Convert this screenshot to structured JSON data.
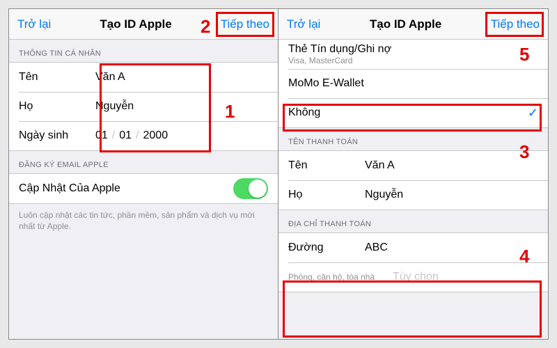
{
  "left": {
    "nav": {
      "back": "Trở lại",
      "title": "Tạo ID Apple",
      "next": "Tiếp theo"
    },
    "sections": {
      "personal_header": "THÔNG TIN CÁ NHÂN",
      "first_name_label": "Tên",
      "first_name_value": "Văn A",
      "last_name_label": "Họ",
      "last_name_value": "Nguyễn",
      "birth_label": "Ngày sinh",
      "birth_d": "01",
      "birth_m": "01",
      "birth_y": "2000",
      "email_header": "ĐĂNG KÝ EMAIL APPLE",
      "updates_label": "Cập Nhật Của Apple",
      "updates_footer": "Luôn cập nhật các tin tức, phần mềm, sản phẩm và dịch vụ mới nhất từ Apple."
    }
  },
  "right": {
    "nav": {
      "back": "Trở lại",
      "title": "Tạo ID Apple",
      "next": "Tiếp theo"
    },
    "payment": {
      "card_label": "Thẻ Tín dụng/Ghi nợ",
      "card_sub": "Visa, MasterCard",
      "momo_label": "MoMo E-Wallet",
      "none_label": "Không"
    },
    "billing_name_header": "TÊN THANH TOÁN",
    "billing_first_label": "Tên",
    "billing_first_value": "Văn A",
    "billing_last_label": "Họ",
    "billing_last_value": "Nguyễn",
    "billing_addr_header": "ĐỊA CHỈ THANH TOÁN",
    "street_label": "Đường",
    "street_value": "ABC",
    "unit_label": "Phòng, căn hộ, tòa nhà",
    "unit_placeholder": "Tùy chọn"
  },
  "annotations": {
    "n1": "1",
    "n2": "2",
    "n3": "3",
    "n4": "4",
    "n5": "5"
  }
}
